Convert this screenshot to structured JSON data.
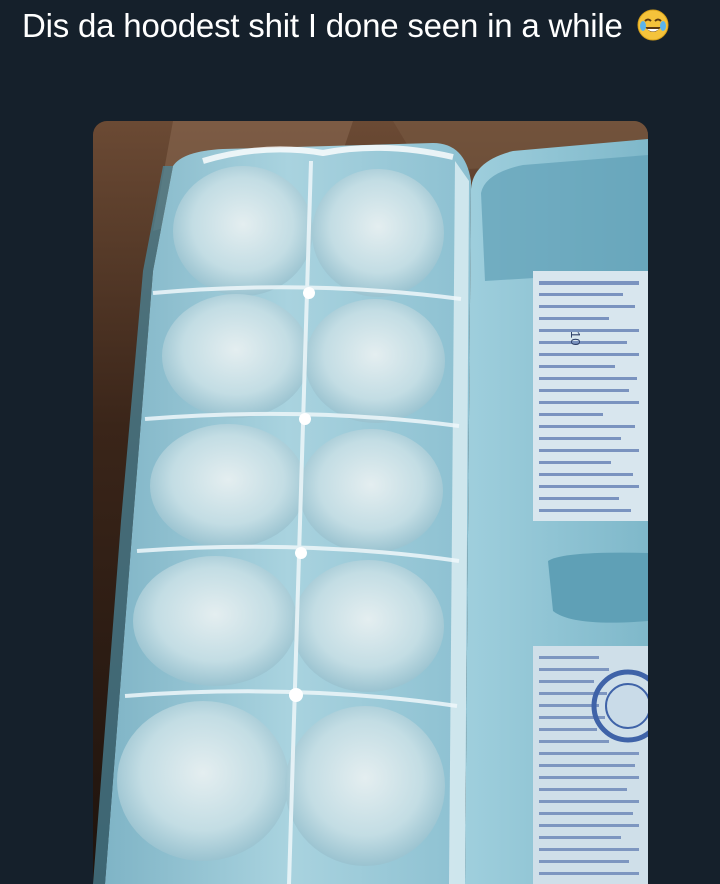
{
  "tweet": {
    "text": "Dis da hoodest shit I done seen in a while",
    "emoji": "crying-laughing-face"
  },
  "photo": {
    "subject": "egg carton used as ice cube tray",
    "label_text": "10"
  },
  "colors": {
    "background": "#15202b",
    "text": "#ffffff",
    "carton": "#8fc3d3"
  }
}
